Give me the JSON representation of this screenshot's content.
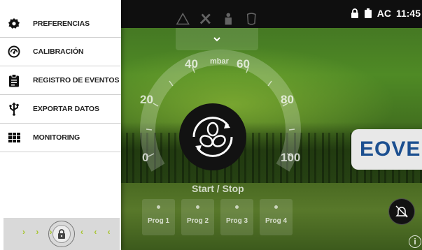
{
  "status": {
    "battery_text": "AC",
    "time": "11:45"
  },
  "menu": {
    "items": [
      {
        "label": "PREFERENCIAS",
        "icon": "gear-icon"
      },
      {
        "label": "CALIBRACIÓN",
        "icon": "gauge-icon"
      },
      {
        "label": "REGISTRO DE EVENTOS",
        "icon": "clipboard-icon"
      },
      {
        "label": "EXPORTAR DATOS",
        "icon": "usb-icon"
      },
      {
        "label": "MONITORING",
        "icon": "grid-icon"
      }
    ]
  },
  "lock": {
    "left_arrows": "› › ›",
    "right_arrows": "‹ ‹ ‹",
    "icon": "lock-icon"
  },
  "gauge": {
    "unit": "mbar",
    "labels": [
      "0",
      "20",
      "40",
      "60",
      "80",
      "100"
    ]
  },
  "controls": {
    "start_stop_label": "Start / Stop",
    "programs": [
      "Prog 1",
      "Prog 2",
      "Prog 3",
      "Prog 4"
    ]
  },
  "brand": {
    "logo_text": "EOVE"
  },
  "info_label": "i",
  "colors": {
    "accent": "#a6c52c",
    "brand_blue": "#1c4f90",
    "drawer_bg": "#ffffff",
    "topbar": "#0f0f0f"
  }
}
